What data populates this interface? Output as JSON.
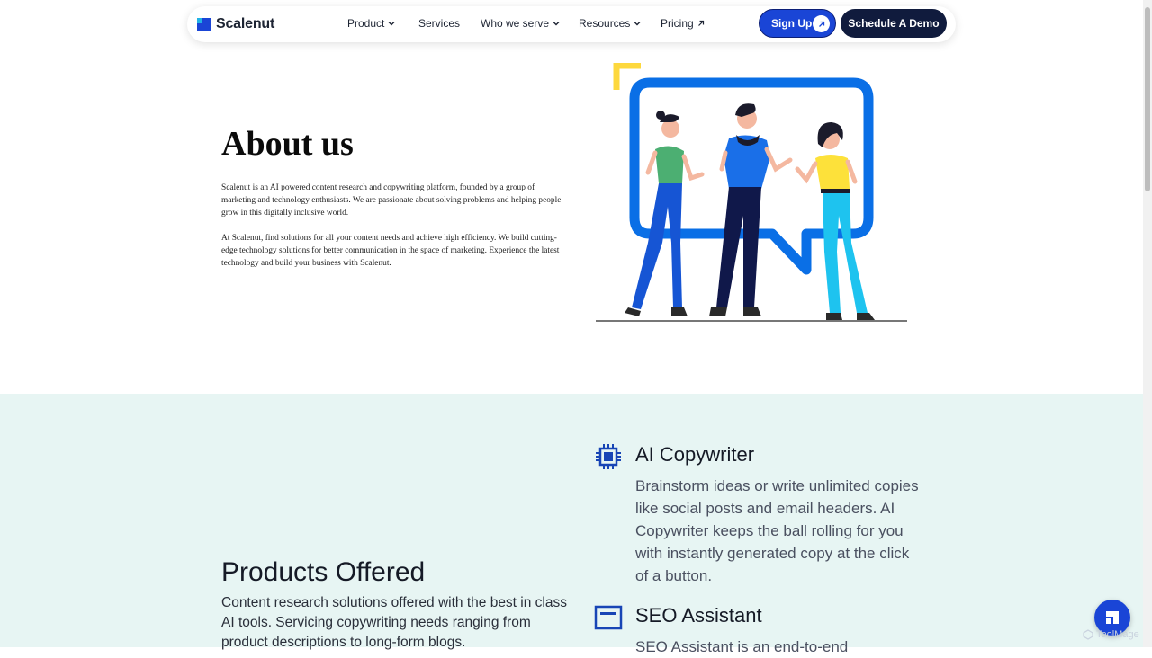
{
  "brand": {
    "name": "Scalenut",
    "accent": "#1a45d6",
    "dark": "#101b3d",
    "illustration_blue": "#0a6fe6",
    "illustration_yellow": "#fdd83d",
    "section_bg": "#e7f5f3"
  },
  "nav": {
    "items": [
      {
        "label": "Product",
        "icon": "chevron-down-icon"
      },
      {
        "label": "Services",
        "icon": ""
      },
      {
        "label": "Who we serve",
        "icon": "chevron-down-icon"
      },
      {
        "label": "Resources",
        "icon": "chevron-down-icon"
      },
      {
        "label": "Pricing",
        "icon": "arrow-up-right-icon"
      }
    ],
    "signup_label": "Sign Up",
    "demo_label": "Schedule A Demo"
  },
  "about": {
    "title": "About us",
    "paragraph1": "Scalenut is an AI powered content research and copywriting platform, founded by a group of marketing and technology enthusiasts. We are passionate about solving problems and helping people grow in this digitally inclusive world.",
    "paragraph2": "At Scalenut, find solutions for all your content needs and achieve high efficiency. We build cutting-edge technology solutions for better communication in the space of marketing. Experience the latest technology and build your business with Scalenut."
  },
  "products": {
    "title": "Products Offered",
    "description": "Content research solutions offered with the best in class AI tools. Servicing copywriting needs ranging from product descriptions to long-form blogs.",
    "features": [
      {
        "title": "AI Copywriter",
        "icon": "cpu-chip-icon",
        "description": "Brainstorm ideas or write unlimited copies like social posts and email headers. AI Copywriter keeps the ball rolling for you with instantly generated copy at the click of a button."
      },
      {
        "title": "SEO Assistant",
        "icon": "window-icon",
        "description": "SEO Assistant is an end-to-end"
      }
    ]
  },
  "watermark": "ToolMage"
}
